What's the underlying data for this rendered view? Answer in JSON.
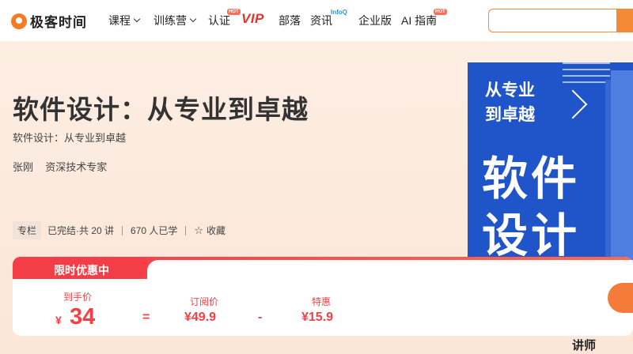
{
  "header": {
    "logo_text": "极客时间",
    "nav": [
      {
        "label": "课程",
        "dropdown": true
      },
      {
        "label": "训练营",
        "dropdown": true
      },
      {
        "label": "认证",
        "badge": "HOT"
      },
      {
        "label": "VIP"
      },
      {
        "label": "部落"
      },
      {
        "label": "资讯",
        "badge": "InfoQ"
      },
      {
        "label": "企业版"
      },
      {
        "label": "AI 指南",
        "badge": "HOT"
      }
    ],
    "search_placeholder": ""
  },
  "course": {
    "title": "软件设计：从专业到卓越",
    "subtitle": "软件设计：从专业到卓越",
    "author": "张刚",
    "author_title": "资深技术专家",
    "tag": "专栏",
    "status": "已完结·共 20 讲",
    "learners": "670 人已学",
    "favorite_label": "收藏"
  },
  "cover": {
    "small_line1": "从专业",
    "small_line2": "到卓越",
    "big_line1": "软件",
    "big_line2": "设计"
  },
  "price": {
    "banner": "限时优惠中",
    "final_label": "到手价",
    "final_currency": "¥",
    "final_value": "34",
    "eq": "=",
    "subscription_label": "订阅价",
    "subscription_value": "¥49.9",
    "minus": "-",
    "discount_label": "特惠",
    "discount_value": "¥15.9"
  },
  "teacher_label": "讲师",
  "colors": {
    "brand_orange": "#f57b24",
    "price_red": "#f43f45",
    "cover_blue": "#1f55c8",
    "vip_red": "#e8312e"
  }
}
